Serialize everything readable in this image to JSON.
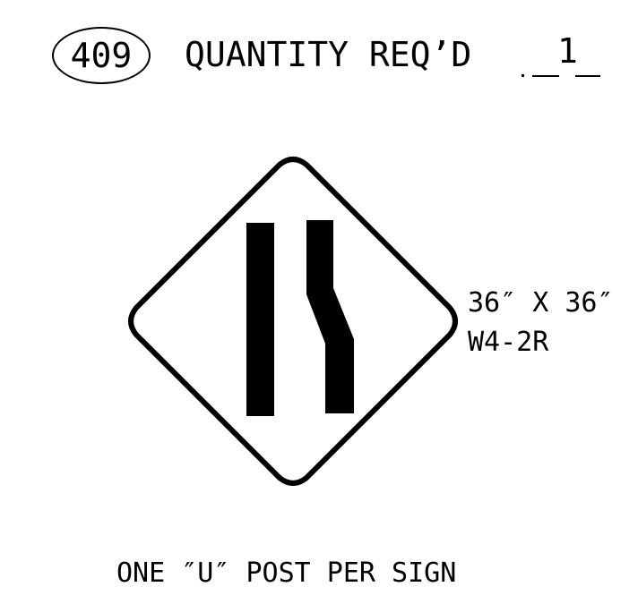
{
  "sheet": {
    "sign_number": "409",
    "quantity_label": "QUANTITY REQ’D",
    "quantity_value": "1"
  },
  "sign": {
    "size": "36″ X 36″",
    "code": "W4-2R",
    "shape": "diamond",
    "symbol": "right-lane-ends-icon"
  },
  "note": {
    "post_text": "ONE ″U″ POST PER SIGN"
  }
}
